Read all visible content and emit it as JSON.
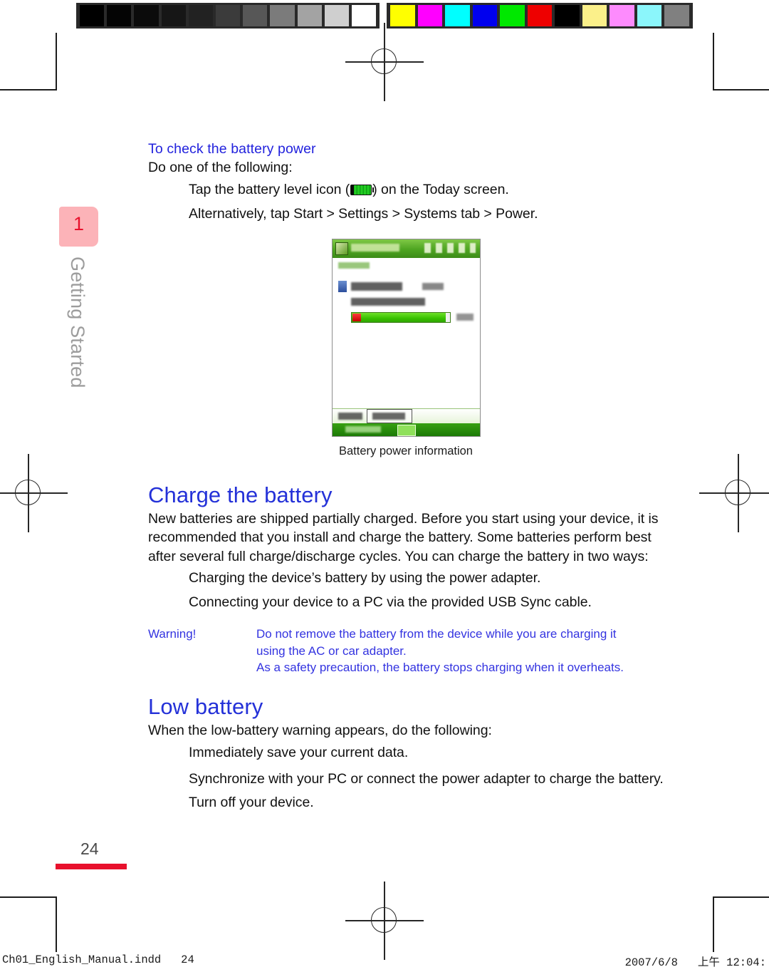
{
  "calibration": {
    "gray_swatches": [
      "#000000",
      "#040404",
      "#0b0b0b",
      "#161616",
      "#222222",
      "#3b3b3b",
      "#575757",
      "#7b7b7b",
      "#a3a3a3",
      "#cfcfcf",
      "#ffffff"
    ],
    "color_swatches": [
      "#ffff00",
      "#ff00ff",
      "#00ffff",
      "#0000ee",
      "#00e800",
      "#ee0000",
      "#000000",
      "#fbf08a",
      "#fd8bfd",
      "#8bf6fb",
      "#808080"
    ]
  },
  "chapter": {
    "number": "1",
    "label": "Getting Started",
    "tab_color": "#fcb3b8",
    "number_color": "#e8112d",
    "label_color": "#9d9d9d"
  },
  "content": {
    "heading1": "To check the battery power",
    "intro1": "Do one of the following:",
    "bullet1_before": "Tap the battery level icon (",
    "bullet1_icon": "battery-level-icon",
    "bullet1_after": ") on the Today screen.",
    "bullet2": "Alternatively, tap Start > Settings > Systems tab > Power.",
    "figure_caption": "Battery power information",
    "heading2": "Charge the battery",
    "para2": "New batteries are shipped partially charged. Before you start using your device, it is recommended that you install and charge the battery. Some batteries perform best after several full charge/discharge cycles. You can charge the battery in two ways:",
    "bullet3": "Charging the device’s battery by using the power adapter.",
    "bullet4": "Connecting your device to a PC via the provided USB Sync cable.",
    "warning_label": "Warning!",
    "warning_line1": "Do not remove the battery from the device while you are charging it",
    "warning_line2": "using the AC or car adapter.",
    "warning_line3": "As a safety precaution, the battery stops charging when it overheats.",
    "heading3": "Low battery",
    "para3": "When the low-battery warning appears, do the following:",
    "bullet5": "Immediately save your current data.",
    "bullet6": "Synchronize with your PC or connect the power adapter to charge the battery.",
    "bullet7": "Turn off your device.",
    "heading_color": "#2222dd",
    "warning_color": "#3333e0"
  },
  "page": {
    "number": "24",
    "rule_color": "#e8112d"
  },
  "footer": {
    "left": "Ch01_English_Manual.indd   24",
    "right": "2007/6/8   上午 12:04:"
  }
}
